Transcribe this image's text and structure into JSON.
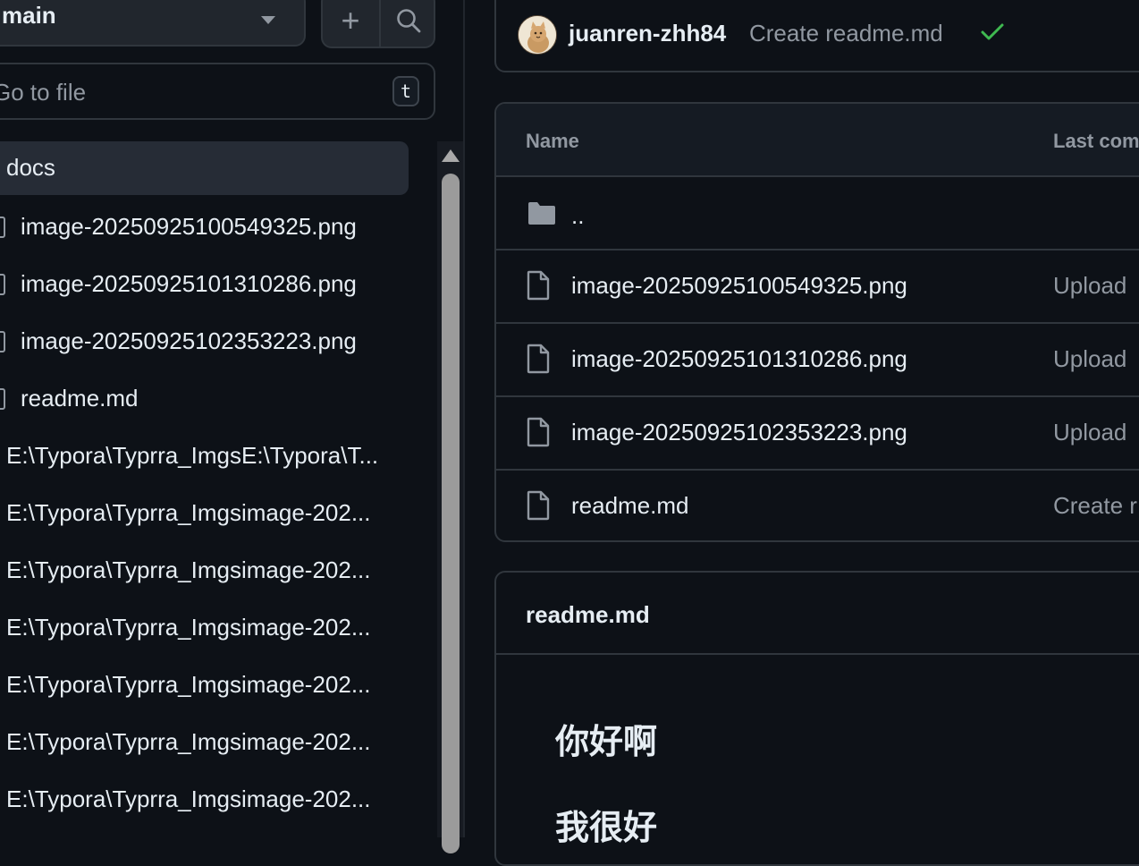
{
  "sidebar": {
    "branch_label": "main",
    "add_button": "+",
    "goto_placeholder": "Go to file",
    "goto_shortcut": "t",
    "items": [
      {
        "label": "docs",
        "selected": true
      },
      {
        "label": "image-20250925100549325.png"
      },
      {
        "label": "image-20250925101310286.png"
      },
      {
        "label": "image-20250925102353223.png"
      },
      {
        "label": "readme.md"
      },
      {
        "label": "E:\\Typora\\Typrra_ImgsE:\\Typora\\T..."
      },
      {
        "label": "E:\\Typora\\Typrra_Imgsimage-202..."
      },
      {
        "label": "E:\\Typora\\Typrra_Imgsimage-202..."
      },
      {
        "label": "E:\\Typora\\Typrra_Imgsimage-202..."
      },
      {
        "label": "E:\\Typora\\Typrra_Imgsimage-202..."
      },
      {
        "label": "E:\\Typora\\Typrra_Imgsimage-202..."
      },
      {
        "label": "E:\\Typora\\Typrra_Imgsimage-202..."
      }
    ]
  },
  "commit": {
    "user": "juanren-zhh84",
    "message": "Create readme.md",
    "status_color": "#3fb950"
  },
  "files": {
    "header_name": "Name",
    "header_last_commit": "Last com",
    "parent_dir": "..",
    "rows": [
      {
        "name": "image-20250925100549325.png",
        "commit": "Upload"
      },
      {
        "name": "image-20250925101310286.png",
        "commit": "Upload"
      },
      {
        "name": "image-20250925102353223.png",
        "commit": "Upload"
      },
      {
        "name": "readme.md",
        "commit": "Create r"
      }
    ]
  },
  "readme": {
    "title": "readme.md",
    "heading1": "你好啊",
    "heading2": "我很好"
  }
}
